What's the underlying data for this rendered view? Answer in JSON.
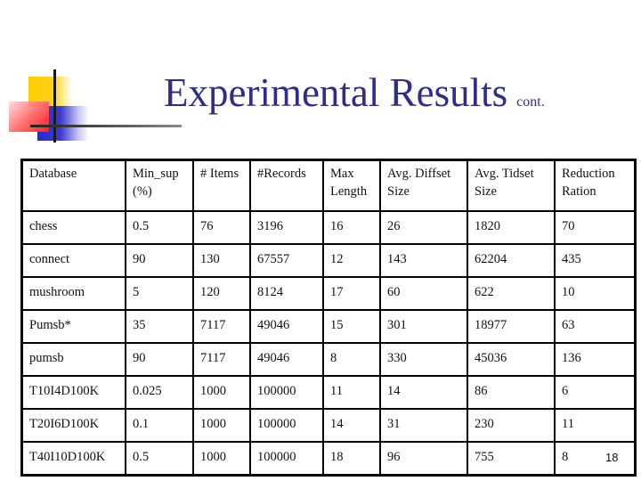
{
  "slide": {
    "title": "Experimental Results",
    "title_suffix": "cont.",
    "page_number": "18",
    "accent_color": "#2e2e8a"
  },
  "table": {
    "headers": [
      [
        "Database"
      ],
      [
        "Min_sup",
        "(%)"
      ],
      [
        "# Items"
      ],
      [
        "#Records"
      ],
      [
        "Max",
        "Length"
      ],
      [
        "Avg. Diffset",
        "Size"
      ],
      [
        "Avg. Tidset",
        "Size"
      ],
      [
        "Reduction",
        "Ration"
      ]
    ],
    "rows": [
      [
        "chess",
        "0.5",
        "76",
        "3196",
        "16",
        "26",
        "1820",
        "70"
      ],
      [
        "connect",
        "90",
        "130",
        "67557",
        "12",
        "143",
        "62204",
        "435"
      ],
      [
        "mushroom",
        "5",
        "120",
        "8124",
        "17",
        "60",
        "622",
        "10"
      ],
      [
        "Pumsb*",
        "35",
        "7117",
        "49046",
        "15",
        "301",
        "18977",
        "63"
      ],
      [
        "pumsb",
        "90",
        "7117",
        "49046",
        "8",
        "330",
        "45036",
        "136"
      ],
      [
        "T10I4D100K",
        "0.025",
        "1000",
        "100000",
        "11",
        "14",
        "86",
        "6"
      ],
      [
        "T20I6D100K",
        "0.1",
        "1000",
        "100000",
        "14",
        "31",
        "230",
        "11"
      ],
      [
        "T40I10D100K",
        "0.5",
        "1000",
        "100000",
        "18",
        "96",
        "755",
        "8"
      ]
    ]
  }
}
